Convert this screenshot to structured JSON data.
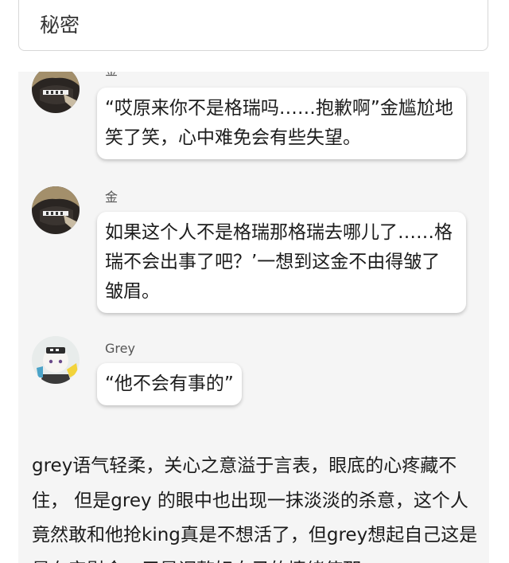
{
  "header": {
    "title": "秘密"
  },
  "messages": [
    {
      "sender": "金",
      "text": "“哎原来你不是格瑞吗……抱歉啊”金尴尬地笑了笑，心中难免会有些失望。",
      "avatar_icon": "dark-haired-character-avatar-icon"
    },
    {
      "sender": "金",
      "text": "如果这个人不是格瑞那格瑞去哪儿了……格瑞不会出事了吧？’一想到这金不由得皱了皱眉。",
      "avatar_icon": "dark-haired-character-avatar-icon"
    },
    {
      "sender": "Grey",
      "text": "“他不会有事的”",
      "avatar_icon": "white-haired-character-avatar-icon"
    }
  ],
  "narration": "grey语气轻柔，关心之意溢于言表，眼底的心疼藏不住， 但是grey 的眼中也出现一抹淡淡的杀意，这个人竟然敢和他抢king真是不想活了，但grey想起自己这是是在安慰金，于是调整好自己的情绪使那",
  "colors": {
    "chat_background": "#f5f5f5",
    "bubble_background": "#ffffff",
    "text": "#1c1c1c"
  }
}
